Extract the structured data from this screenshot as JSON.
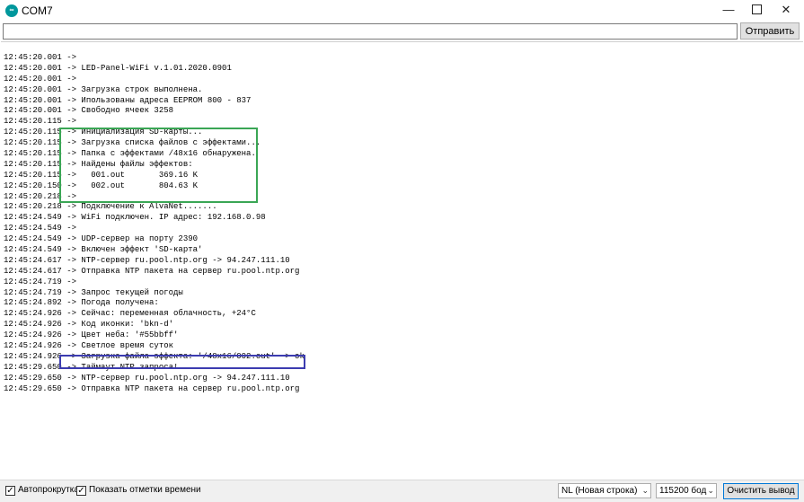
{
  "window": {
    "title": "COM7",
    "app_icon_text": "∞",
    "minimize_glyph": "—",
    "close_glyph": "✕"
  },
  "send_bar": {
    "input_value": "",
    "send_label": "Отправить"
  },
  "log_lines": [
    "12:45:20.001 ->",
    "12:45:20.001 -> LED-Panel-WiFi v.1.01.2020.0901",
    "12:45:20.001 ->",
    "12:45:20.001 -> Загрузка строк выполнена.",
    "12:45:20.001 -> Ипользованы адреса EEPROM 800 - 837",
    "12:45:20.001 -> Свободно ячеек 3258",
    "12:45:20.115 ->",
    "12:45:20.115 -> Инициализация SD-карты...",
    "12:45:20.115 -> Загрузка списка файлов с эффектами...",
    "12:45:20.115 -> Папка с эффектами /48x16 обнаружена.",
    "12:45:20.115 -> Найдены файлы эффектов:",
    "12:45:20.115 ->   001.out       369.16 K",
    "12:45:20.150 ->   002.out       804.63 K",
    "12:45:20.218 ->",
    "12:45:20.218 -> Подключение к AlvaNet.......",
    "12:45:24.549 -> WiFi подключен. IP адрес: 192.168.0.98",
    "12:45:24.549 ->",
    "12:45:24.549 -> UDP-сервер на порту 2390",
    "12:45:24.549 -> Включен эффект 'SD-карта'",
    "12:45:24.617 -> NTP-сервер ru.pool.ntp.org -> 94.247.111.10",
    "12:45:24.617 -> Отправка NTP пакета на сервер ru.pool.ntp.org",
    "12:45:24.719 ->",
    "12:45:24.719 -> Запрос текущей погоды",
    "12:45:24.892 -> Погода получена:",
    "12:45:24.926 -> Сейчас: переменная облачность, +24°C",
    "12:45:24.926 -> Код иконки: 'bkn-d'",
    "12:45:24.926 -> Цвет неба: '#55bbff'",
    "12:45:24.926 -> Светлое время суток",
    "12:45:24.926 -> Загрузка файла эффекта: '/48x16/002.out' -> ok",
    "12:45:29.650 -> Таймаут NTP запроса!",
    "12:45:29.650 -> NTP-сервер ru.pool.ntp.org -> 94.247.111.10",
    "12:45:29.650 -> Отправка NTP пакета на сервер ru.pool.ntp.org"
  ],
  "statusbar": {
    "autoscroll_label": "Автопрокрутка",
    "autoscroll_checked": true,
    "timestamps_label": "Показать отметки времени",
    "timestamps_checked": true,
    "line_ending": "NL (Новая строка)",
    "baud_rate": "115200 бод",
    "clear_label": "Очистить вывод",
    "check_glyph": "✓",
    "dropdown_glyph": "⌄"
  },
  "highlight_colors": {
    "green": "#3aa655",
    "blue": "#3c3cb0"
  }
}
